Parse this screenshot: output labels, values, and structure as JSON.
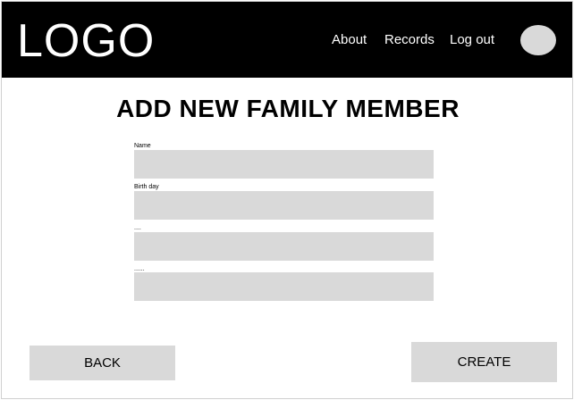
{
  "header": {
    "logo": "LOGO",
    "nav": {
      "about": "About",
      "records": "Records",
      "logout": "Log out"
    }
  },
  "page": {
    "title": "ADD NEW FAMILY MEMBER"
  },
  "form": {
    "fields": [
      {
        "label": "Name",
        "value": ""
      },
      {
        "label": "Birth day",
        "value": ""
      },
      {
        "label": "....",
        "value": ""
      },
      {
        "label": "......",
        "value": ""
      }
    ]
  },
  "actions": {
    "back_label": "BACK",
    "create_label": "CREATE"
  },
  "colors": {
    "header_bg": "#000000",
    "field_bg": "#d9d9d9",
    "button_bg": "#d9d9d9"
  }
}
